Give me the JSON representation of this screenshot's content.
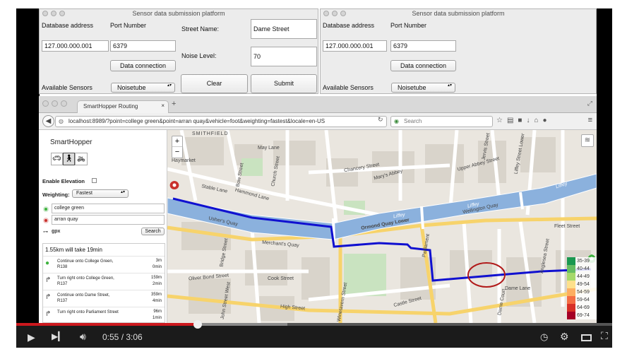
{
  "sensor_windows": [
    {
      "title": "Sensor data submission platform",
      "db_label": "Database address",
      "port_label": "Port Number",
      "db_value": "127.000.000.001",
      "port_value": "6379",
      "connect_label": "Data connection",
      "sensors_label": "Available Sensors",
      "sensor_selected": "Noisetube",
      "street_label": "Street Name:",
      "street_value": "Dame Street",
      "noise_label": "Noise Level:",
      "noise_value": "70",
      "clear_label": "Clear",
      "submit_label": "Submit"
    },
    {
      "title": "Sensor data submission platform",
      "db_label": "Database address",
      "port_label": "Port Number",
      "db_value": "127.000.000.001",
      "port_value": "6379",
      "connect_label": "Data connection",
      "sensors_label": "Available Sensors",
      "sensor_selected": "Noisetube"
    }
  ],
  "browser": {
    "tab_title": "SmartHopper Routing",
    "url": "localhost:8989/?point=college green&point=arran quay&vehicle=foot&weighting=fastest&locale=en-US",
    "search_placeholder": "Search"
  },
  "sidebar": {
    "brand": "SmartHopper",
    "elevation_label": "Enable Elevation",
    "weighting_label": "Weighting:",
    "weighting_value": "Fastest",
    "from_value": "college green",
    "to_value": "arran quay",
    "gpx_label": "gpx",
    "search_button": "Search",
    "summary": "1.55km will take 19min",
    "instructions": [
      {
        "text": "Continue onto College Green, R138",
        "dist": "3m",
        "time": "0min"
      },
      {
        "text": "Turn right onto College Green, R137",
        "dist": "159m",
        "time": "2min"
      },
      {
        "text": "Continue onto Dame Street, R137",
        "dist": "359m",
        "time": "4min"
      },
      {
        "text": "Turn right onto Parliament Street",
        "dist": "96m",
        "time": "1min"
      }
    ]
  },
  "map": {
    "zoom_in": "+",
    "zoom_out": "−",
    "labels": {
      "smithfield": "SMITHFIELD",
      "haymarket": "Haymarket",
      "may_lane": "May Lane",
      "bow_street": "Bow Street",
      "stable_lane": "Stable Lane",
      "hammond_lane": "Hammond Lane",
      "chancery_street": "Chancery Street",
      "marys_abbey": "Mary's Abbey",
      "ormond_quay": "Ormond Quay Lower",
      "wellington_quay": "Wellington Quay",
      "liffey1": "Liffey",
      "liffey2": "Liffey",
      "liffey3": "Liffey",
      "ushers_quay": "Usher's Quay",
      "merchants_quay": "Merchant's Quay",
      "cook_street": "Cook Street",
      "high_street": "High Street",
      "castle_street": "Castle Street",
      "dame_lane": "Dame Lane",
      "fleet_street": "Fleet Street",
      "oliver_bond": "Oliver Bond Street",
      "john_street": "John Street West",
      "upper_abbey": "Upper Abbey Street",
      "jervis_street": "Jervis Street",
      "liffey_street": "Liffey Street Lower",
      "dame_court": "Dame Court",
      "parliament": "Parliament",
      "church_street": "Church Street",
      "winetavern": "Winetavern Street",
      "bridge_street": "Bridge Street",
      "anglesea": "Anglesea Street"
    },
    "legend": [
      "35-39",
      "40-44",
      "44-49",
      "49-54",
      "54-59",
      "59-64",
      "64-69",
      "69-74"
    ],
    "legend_colors": [
      "#1a9850",
      "#66bd63",
      "#a6d96a",
      "#fee08b",
      "#fdae61",
      "#f46d43",
      "#d73027",
      "#a50026"
    ],
    "route_color": "#1010d0",
    "highlight_color": "#b11a1a"
  },
  "player": {
    "time": "0:55 / 3:06",
    "progress": 0.087,
    "buffered": 0.13
  }
}
